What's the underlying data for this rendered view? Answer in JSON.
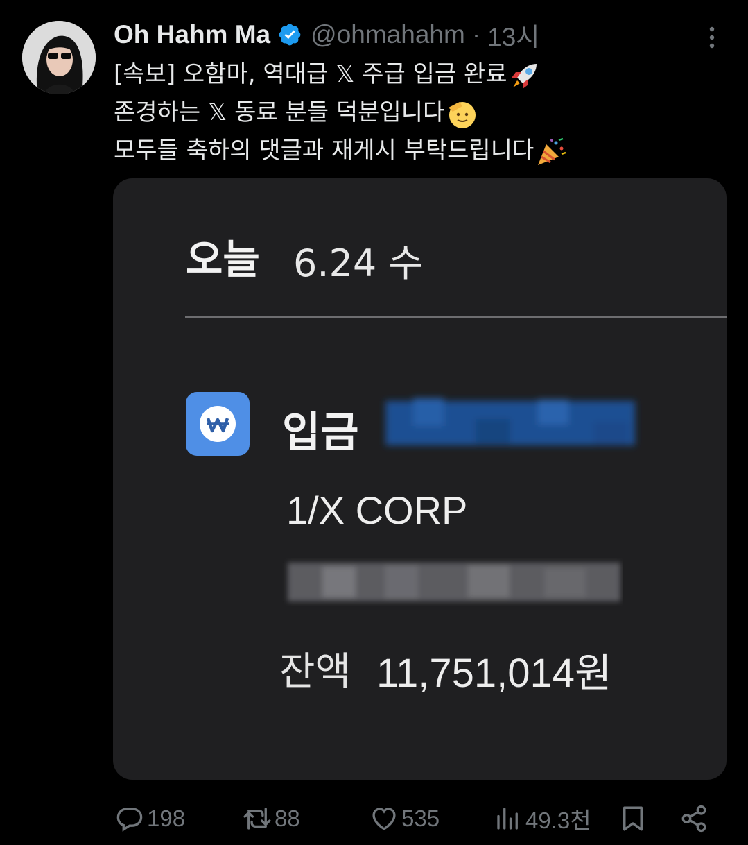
{
  "tweet": {
    "author_name": "Oh Hahm Ma",
    "handle": "@ohmahahm",
    "separator": "·",
    "time": "13시",
    "lines": [
      "[속보] 오함마, 역대급 𝕏 주급 입금 완료",
      "존경하는 𝕏 동료 분들 덕분입니다",
      "모두들 축하의 댓글과 재게시 부탁드립니다"
    ],
    "emojis": [
      "rocket-emoji",
      "saluting-face-emoji",
      "party-popper-emoji"
    ]
  },
  "media": {
    "today_label": "오늘",
    "date": "6.24 수",
    "deposit_label": "입금",
    "sender": "1/X CORP",
    "balance_label": "잔액",
    "balance_amount": "11,751,014원",
    "icon": "won-sign-icon"
  },
  "actions": {
    "replies": "198",
    "reposts": "88",
    "likes": "535",
    "views": "49.3천"
  },
  "colors": {
    "background": "#000000",
    "text": "#e7e9ea",
    "muted": "#71767b",
    "verified": "#1d9bf0",
    "card": "#1f1f21",
    "bank_icon": "#4f8fe6"
  }
}
